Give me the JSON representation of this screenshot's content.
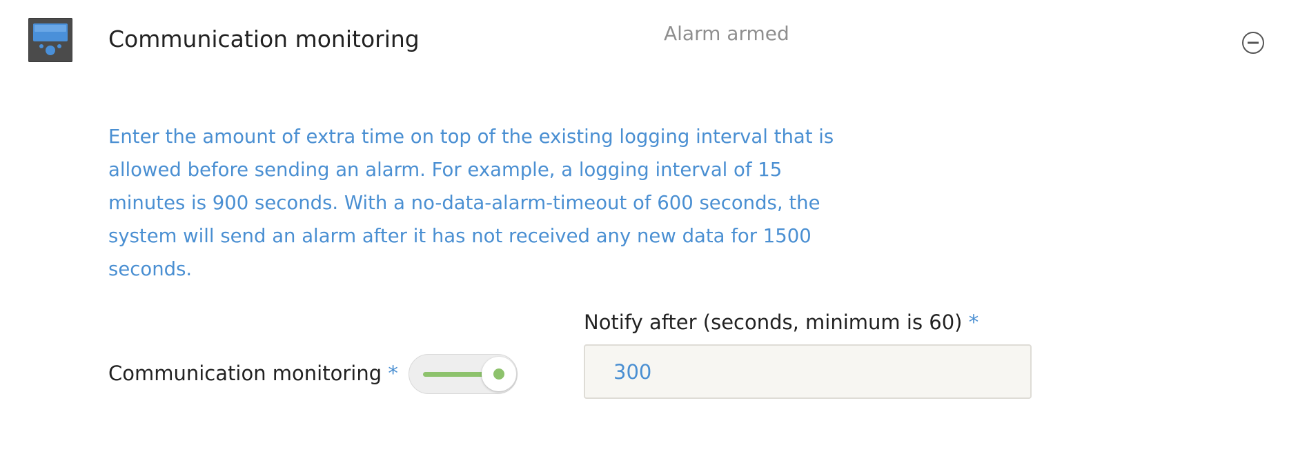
{
  "header": {
    "icon": "device-monitor-icon",
    "title": "Communication monitoring",
    "status": "Alarm armed",
    "collapse_icon": "minus-circle-icon"
  },
  "description": {
    "lines": [
      "Enter the amount of extra time on top of the existing logging interval that is",
      "allowed before sending an alarm. For example, a logging interval of 15",
      "minutes is 900 seconds. With a no-data-alarm-timeout of 600 seconds, the",
      "system will send an alarm after it has not received any new data for 1500",
      "seconds."
    ]
  },
  "form": {
    "monitoring_label": "Communication monitoring",
    "required_marker": "*",
    "monitoring_enabled": true,
    "notify_label": "Notify after (seconds, minimum is 60)",
    "notify_value": "300"
  },
  "colors": {
    "accent_blue": "#4a8fd2",
    "toggle_green": "#8dc26c",
    "status_gray": "#8e8e8e"
  }
}
